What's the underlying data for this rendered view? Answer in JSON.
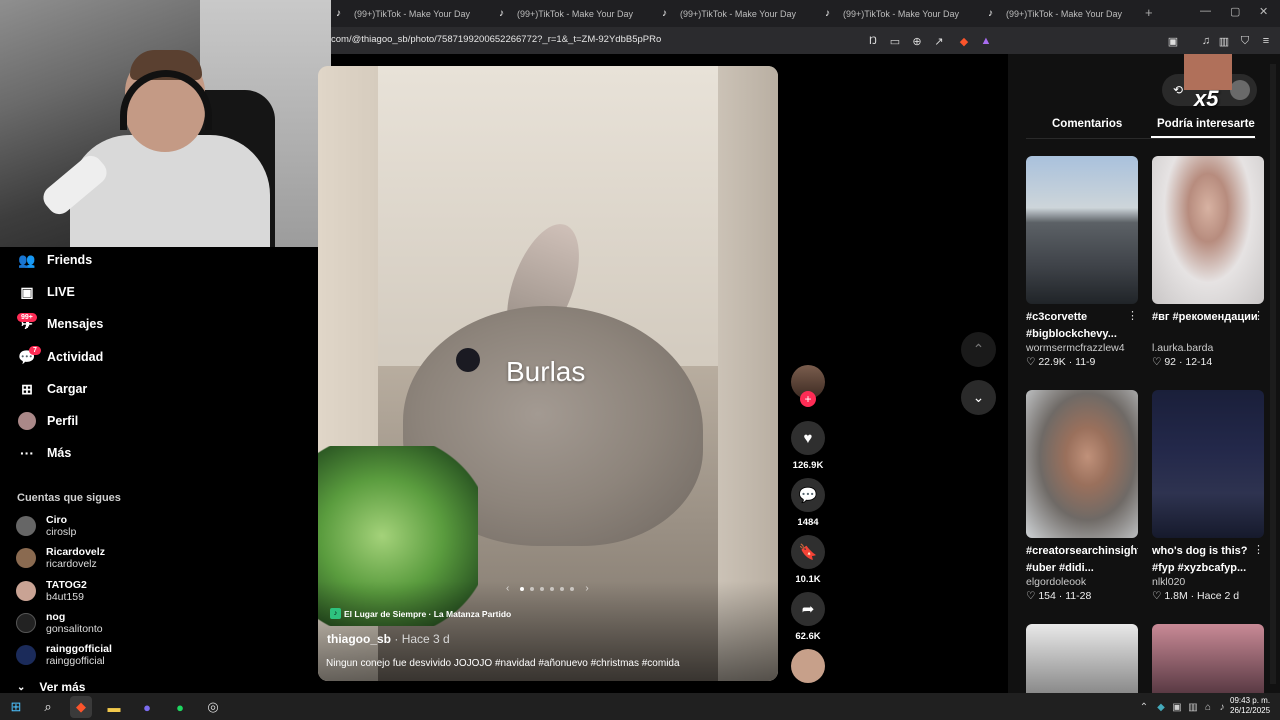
{
  "browser": {
    "tabs": [
      "(99+)TikTok - Make Your Day",
      "(99+)TikTok - Make Your Day",
      "(99+)TikTok - Make Your Day",
      "(99+)TikTok - Make Your Day",
      "(99+)TikTok - Make Your Day"
    ],
    "url": "com/@thiagoo_sb/photo/7587199200652266772?_r=1&_t=ZM-92YdbB5pPRo"
  },
  "nav": {
    "items": [
      {
        "label": "Friends",
        "icon": "friends-icon"
      },
      {
        "label": "LIVE",
        "icon": "live-icon"
      },
      {
        "label": "Mensajes",
        "icon": "messages-icon",
        "badge": "99+"
      },
      {
        "label": "Actividad",
        "icon": "activity-icon",
        "badge": "7"
      },
      {
        "label": "Cargar",
        "icon": "upload-icon"
      },
      {
        "label": "Perfil",
        "icon": "profile-icon"
      },
      {
        "label": "Más",
        "icon": "more-icon"
      }
    ],
    "following_title": "Cuentas que sigues",
    "following": [
      {
        "name": "Ciro",
        "handle": "ciroslp"
      },
      {
        "name": "Ricardovelz",
        "handle": "ricardovelz"
      },
      {
        "name": "TATOG2",
        "handle": "b4ut159"
      },
      {
        "name": "nog",
        "handle": "gonsalitonto"
      },
      {
        "name": "rainggofficial",
        "handle": "rainggofficial"
      }
    ],
    "see_more": "Ver más"
  },
  "post": {
    "overlay_text": "Burlas",
    "music": "El Lugar de Siempre · La Matanza Partido",
    "author": "thiagoo_sb",
    "time": "· Hace 3 d",
    "caption": "Ningun conejo fue desvivido JOJOJO #navidad #añonuevo #christmas #comida",
    "likes": "126.9K",
    "comments": "1484",
    "saves": "10.1K",
    "shares": "62.6K"
  },
  "right_panel": {
    "tab_comments": "Comentarios",
    "tab_suggested": "Podría interesarte",
    "overlay_badge": "x5",
    "cards": [
      {
        "title": "#c3corvette #bigblockchevy...",
        "user": "wormsermcfrazzlew4",
        "likes": "22.9K",
        "date": "11-9"
      },
      {
        "title": "#вг #рекомендации",
        "user": "l.aurka.barda",
        "likes": "92",
        "date": "12-14"
      },
      {
        "title": "#creatorsearchinsights #uber #didi...",
        "user": "elgordoleook",
        "likes": "154",
        "date": "11-28"
      },
      {
        "title": "who's dog is this? #fyp #xyzbcafyp...",
        "user": "nlkl020",
        "likes": "1.8M",
        "date": "Hace 2 d"
      }
    ]
  },
  "taskbar": {
    "time": "09:43 p. m.",
    "date": "26/12/2025"
  },
  "colors": {
    "accent": "#fe2c55",
    "panel": "#111111",
    "background": "#000000"
  }
}
